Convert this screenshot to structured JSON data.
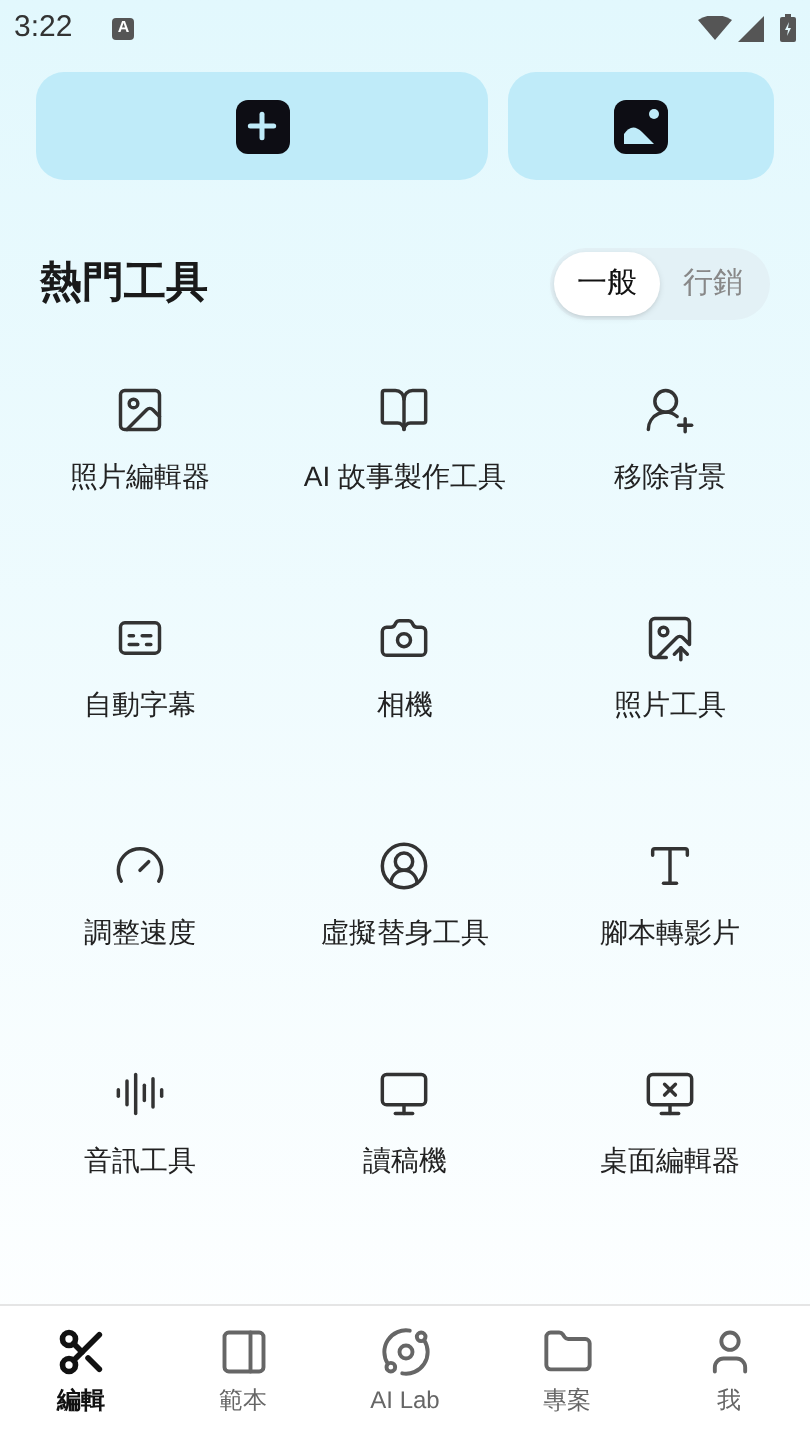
{
  "status_bar": {
    "time": "3:22",
    "notification": "A"
  },
  "section": {
    "title": "熱門工具",
    "segments": [
      {
        "label": "一般",
        "selected": true
      },
      {
        "label": "行銷",
        "selected": false
      }
    ]
  },
  "tools": [
    {
      "label": "照片編輯器"
    },
    {
      "label": "AI 故事製作工具"
    },
    {
      "label": "移除背景"
    },
    {
      "label": "自動字幕"
    },
    {
      "label": "相機"
    },
    {
      "label": "照片工具"
    },
    {
      "label": "調整速度"
    },
    {
      "label": "虛擬替身工具"
    },
    {
      "label": "腳本轉影片"
    },
    {
      "label": "音訊工具"
    },
    {
      "label": "讀稿機"
    },
    {
      "label": "桌面編輯器"
    }
  ],
  "bottom_nav": [
    {
      "label": "編輯",
      "selected": true
    },
    {
      "label": "範本",
      "selected": false
    },
    {
      "label": "AI Lab",
      "selected": false
    },
    {
      "label": "專案",
      "selected": false
    },
    {
      "label": "我",
      "selected": false
    }
  ]
}
